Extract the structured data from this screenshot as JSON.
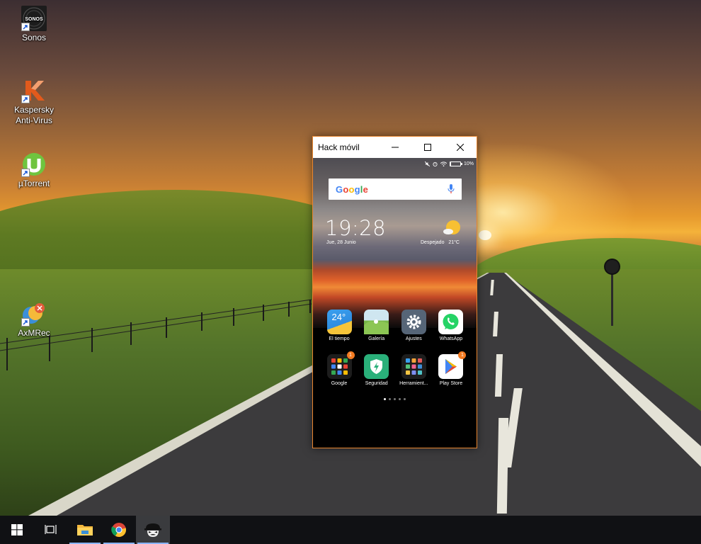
{
  "desktop": {
    "icons": [
      {
        "label": "Sonos",
        "icon": "sonos-icon"
      },
      {
        "label": "Kaspersky Anti-Virus",
        "line1": "Kaspersky",
        "line2": "Anti-Virus",
        "icon": "kaspersky-icon"
      },
      {
        "label": "µTorrent",
        "icon": "utorrent-icon"
      },
      {
        "label": "AxMRec",
        "icon": "axmrec-icon"
      }
    ]
  },
  "window": {
    "title": "Hack móvil",
    "buttons": {
      "minimize": "minimize-icon",
      "maximize": "maximize-icon",
      "close": "close-icon"
    },
    "accent_color": "#e8862f"
  },
  "phone": {
    "status": {
      "battery": "10%",
      "battery_level": 0.1
    },
    "search": {
      "logo": [
        "G",
        "o",
        "o",
        "g",
        "l",
        "e"
      ],
      "logo_colors": [
        "#4285f4",
        "#ea4335",
        "#fbbc05",
        "#4285f4",
        "#34a853",
        "#ea4335"
      ]
    },
    "clock": "19:28",
    "date": "Jue, 28 Junio",
    "weather": {
      "condition": "Despejado",
      "temp": "21°C"
    },
    "apps_row1": [
      {
        "label": "El tiempo",
        "icon": "weather-app-icon",
        "text": "24°"
      },
      {
        "label": "Galería",
        "icon": "gallery-icon"
      },
      {
        "label": "Ajustes",
        "icon": "settings-icon"
      },
      {
        "label": "WhatsApp",
        "icon": "whatsapp-icon"
      }
    ],
    "apps_row2": [
      {
        "label": "Google",
        "icon": "google-folder-icon",
        "badge": "1"
      },
      {
        "label": "Seguridad",
        "icon": "security-icon"
      },
      {
        "label": "Herramient...",
        "icon": "tools-folder-icon"
      },
      {
        "label": "Play Store",
        "icon": "play-store-icon",
        "badge": "1"
      }
    ],
    "pages": {
      "count": 5,
      "active": 1
    }
  },
  "taskbar": {
    "items": [
      {
        "name": "start-button",
        "icon": "windows-icon"
      },
      {
        "name": "task-view-button",
        "icon": "task-view-icon"
      },
      {
        "name": "file-explorer-button",
        "icon": "folder-icon"
      },
      {
        "name": "chrome-button",
        "icon": "chrome-icon"
      },
      {
        "name": "hack-movil-button",
        "icon": "hacker-mask-icon"
      }
    ]
  }
}
